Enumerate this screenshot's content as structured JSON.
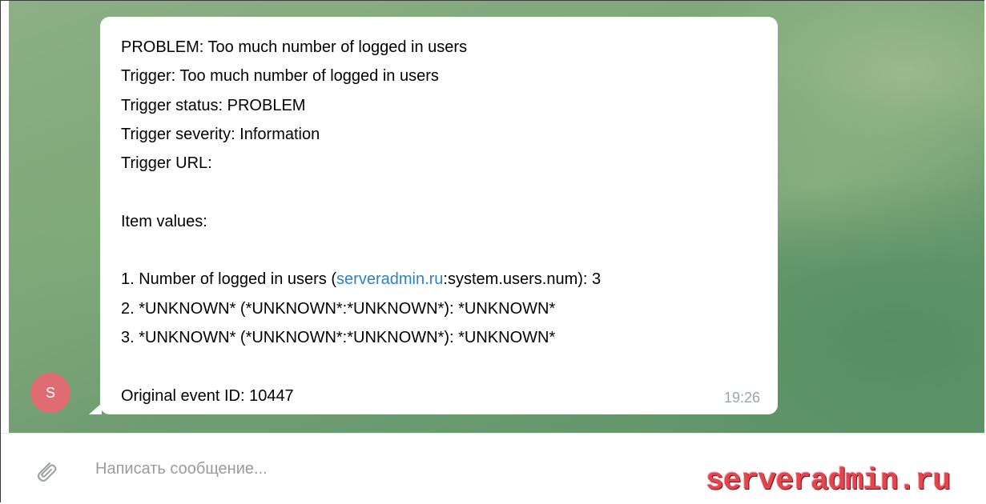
{
  "message": {
    "lines": [
      "PROBLEM: Too much number of logged in users",
      "Trigger: Too much number of logged in users",
      "Trigger status: PROBLEM",
      "Trigger severity: Information",
      "Trigger URL:",
      "",
      "Item values:",
      "",
      {
        "before": "1. Number of logged in users (",
        "link": "serveradmin.ru",
        "after": ":system.users.num): 3"
      },
      "2. *UNKNOWN* (*UNKNOWN*:*UNKNOWN*): *UNKNOWN*",
      "3. *UNKNOWN* (*UNKNOWN*:*UNKNOWN*): *UNKNOWN*",
      "",
      "Original event ID: 10447"
    ],
    "time": "19:26"
  },
  "sender": {
    "avatar_initial": "S",
    "avatar_color": "#e06c73"
  },
  "composer": {
    "placeholder": "Написать сообщение...",
    "value": ""
  },
  "watermark": {
    "text": "serveradmin.ru",
    "color": "#e3454e"
  },
  "icons": {
    "attach": "paperclip-icon"
  }
}
